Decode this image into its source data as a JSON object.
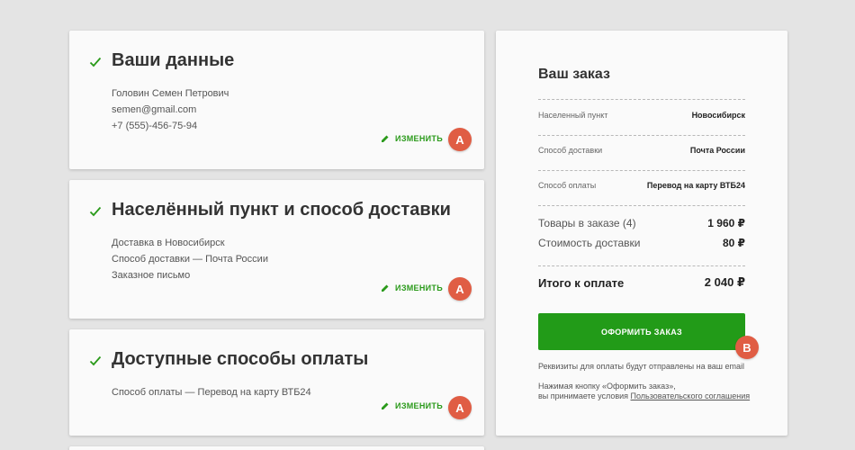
{
  "sections": [
    {
      "title": "Ваши данные",
      "lines": [
        "Головин Семен Петрович",
        "semen@gmail.com",
        "+7 (555)-456-75-94"
      ],
      "edit_label": "ИЗМЕНИТЬ",
      "badge": "A"
    },
    {
      "title": "Населённый пункт и способ доставки",
      "lines": [
        "Доставка в Новосибирск",
        "Способ доставки — Почта России",
        "Заказное письмо"
      ],
      "edit_label": "ИЗМЕНИТЬ",
      "badge": "A"
    },
    {
      "title": "Доступные способы оплаты",
      "lines": [
        "Способ оплаты — Перевод на карту ВТБ24"
      ],
      "edit_label": "ИЗМЕНИТЬ",
      "badge": "A"
    }
  ],
  "order": {
    "title": "Ваш заказ",
    "details": [
      {
        "label": "Населенный пункт",
        "value": "Новосибирск"
      },
      {
        "label": "Способ доставки",
        "value": "Почта России"
      },
      {
        "label": "Способ оплаты",
        "value": "Перевод на карту ВТБ24"
      }
    ],
    "items_label": "Товары в заказе (4)",
    "items_value": "1 960 ₽",
    "delivery_label": "Стоимость доставки",
    "delivery_value": "80 ₽",
    "total_label": "Итого к оплате",
    "total_value": "2 040 ₽",
    "submit_label": "ОФОРМИТЬ ЗАКАЗ",
    "submit_badge": "B",
    "note_email": "Реквизиты для оплаты будут отправлены на ваш email",
    "note_agree_line1": "Нажимая кнопку «Оформить заказ»,",
    "note_agree_prefix": "вы принимаете условия ",
    "note_agree_link": "Пользовательского соглашения"
  },
  "colors": {
    "accent_green": "#229b18",
    "badge_red": "#e05d44",
    "background": "#e4e4e4"
  },
  "icons": {
    "check": "check-icon",
    "edit": "pencil-icon"
  }
}
